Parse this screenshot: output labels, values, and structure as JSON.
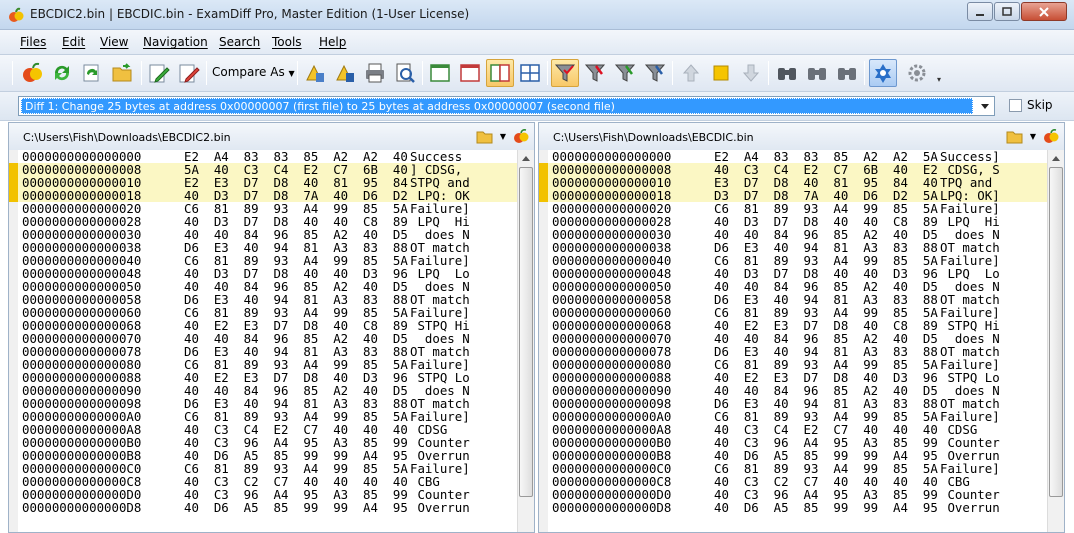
{
  "window": {
    "title": "EBCDIC2.bin  |  EBCDIC.bin - ExamDiff Pro, Master Edition (1-User License)"
  },
  "menu": [
    "Files",
    "Edit",
    "View",
    "Navigation",
    "Search",
    "Tools",
    "Help"
  ],
  "toolbar": {
    "compare_as_label": "Compare As"
  },
  "diff_nav": {
    "current": "Diff 1: Change 25 bytes at address 0x00000007 (first file) to 25 bytes at address 0x00000007 (second file)",
    "skip_label": "Skip"
  },
  "left_pane": {
    "path": "C:\\Users\\Fish\\Downloads\\EBCDIC2.bin",
    "rows": [
      {
        "addr": "0000000000000000",
        "bytes": "E2  A4  83  83  85  A2  A2  40",
        "ascii": "Success "
      },
      {
        "addr": "0000000000000008",
        "bytes": "5A  40  C3  C4  E2  C7  6B  40",
        "ascii": "] CDSG, "
      },
      {
        "addr": "0000000000000010",
        "bytes": "E2  E3  D7  D8  40  81  95  84",
        "ascii": "STPQ and"
      },
      {
        "addr": "0000000000000018",
        "bytes": "40  D3  D7  D8  7A  40  D6  D2",
        "ascii": " LPQ: OK"
      },
      {
        "addr": "0000000000000020",
        "bytes": "C6  81  89  93  A4  99  85  5A",
        "ascii": "Failure]"
      },
      {
        "addr": "0000000000000028",
        "bytes": "40  D3  D7  D8  40  40  C8  89",
        "ascii": " LPQ  Hi"
      },
      {
        "addr": "0000000000000030",
        "bytes": "40  40  84  96  85  A2  40  D5",
        "ascii": "  does N"
      },
      {
        "addr": "0000000000000038",
        "bytes": "D6  E3  40  94  81  A3  83  88",
        "ascii": "OT match"
      },
      {
        "addr": "0000000000000040",
        "bytes": "C6  81  89  93  A4  99  85  5A",
        "ascii": "Failure]"
      },
      {
        "addr": "0000000000000048",
        "bytes": "40  D3  D7  D8  40  40  D3  96",
        "ascii": " LPQ  Lo"
      },
      {
        "addr": "0000000000000050",
        "bytes": "40  40  84  96  85  A2  40  D5",
        "ascii": "  does N"
      },
      {
        "addr": "0000000000000058",
        "bytes": "D6  E3  40  94  81  A3  83  88",
        "ascii": "OT match"
      },
      {
        "addr": "0000000000000060",
        "bytes": "C6  81  89  93  A4  99  85  5A",
        "ascii": "Failure]"
      },
      {
        "addr": "0000000000000068",
        "bytes": "40  E2  E3  D7  D8  40  C8  89",
        "ascii": " STPQ Hi"
      },
      {
        "addr": "0000000000000070",
        "bytes": "40  40  84  96  85  A2  40  D5",
        "ascii": "  does N"
      },
      {
        "addr": "0000000000000078",
        "bytes": "D6  E3  40  94  81  A3  83  88",
        "ascii": "OT match"
      },
      {
        "addr": "0000000000000080",
        "bytes": "C6  81  89  93  A4  99  85  5A",
        "ascii": "Failure]"
      },
      {
        "addr": "0000000000000088",
        "bytes": "40  E2  E3  D7  D8  40  D3  96",
        "ascii": " STPQ Lo"
      },
      {
        "addr": "0000000000000090",
        "bytes": "40  40  84  96  85  A2  40  D5",
        "ascii": "  does N"
      },
      {
        "addr": "0000000000000098",
        "bytes": "D6  E3  40  94  81  A3  83  88",
        "ascii": "OT match"
      },
      {
        "addr": "00000000000000A0",
        "bytes": "C6  81  89  93  A4  99  85  5A",
        "ascii": "Failure]"
      },
      {
        "addr": "00000000000000A8",
        "bytes": "40  C3  C4  E2  C7  40  40  40",
        "ascii": " CDSG   "
      },
      {
        "addr": "00000000000000B0",
        "bytes": "40  C3  96  A4  95  A3  85  99",
        "ascii": " Counter"
      },
      {
        "addr": "00000000000000B8",
        "bytes": "40  D6  A5  85  99  99  A4  95",
        "ascii": " Overrun"
      },
      {
        "addr": "00000000000000C0",
        "bytes": "C6  81  89  93  A4  99  85  5A",
        "ascii": "Failure]"
      },
      {
        "addr": "00000000000000C8",
        "bytes": "40  C3  C2  C7  40  40  40  40",
        "ascii": " CBG    "
      },
      {
        "addr": "00000000000000D0",
        "bytes": "40  C3  96  A4  95  A3  85  99",
        "ascii": " Counter"
      },
      {
        "addr": "00000000000000D8",
        "bytes": "40  D6  A5  85  99  99  A4  95",
        "ascii": " Overrun"
      }
    ]
  },
  "right_pane": {
    "path": "C:\\Users\\Fish\\Downloads\\EBCDIC.bin",
    "rows": [
      {
        "addr": "0000000000000000",
        "bytes": "E2  A4  83  83  85  A2  A2  5A",
        "ascii": "Success]"
      },
      {
        "addr": "0000000000000008",
        "bytes": "40  C3  C4  E2  C7  6B  40  E2",
        "ascii": " CDSG, S"
      },
      {
        "addr": "0000000000000010",
        "bytes": "E3  D7  D8  40  81  95  84  40",
        "ascii": "TPQ and "
      },
      {
        "addr": "0000000000000018",
        "bytes": "D3  D7  D8  7A  40  D6  D2  5A",
        "ascii": "LPQ: OK]"
      },
      {
        "addr": "0000000000000020",
        "bytes": "C6  81  89  93  A4  99  85  5A",
        "ascii": "Failure]"
      },
      {
        "addr": "0000000000000028",
        "bytes": "40  D3  D7  D8  40  40  C8  89",
        "ascii": " LPQ  Hi"
      },
      {
        "addr": "0000000000000030",
        "bytes": "40  40  84  96  85  A2  40  D5",
        "ascii": "  does N"
      },
      {
        "addr": "0000000000000038",
        "bytes": "D6  E3  40  94  81  A3  83  88",
        "ascii": "OT match"
      },
      {
        "addr": "0000000000000040",
        "bytes": "C6  81  89  93  A4  99  85  5A",
        "ascii": "Failure]"
      },
      {
        "addr": "0000000000000048",
        "bytes": "40  D3  D7  D8  40  40  D3  96",
        "ascii": " LPQ  Lo"
      },
      {
        "addr": "0000000000000050",
        "bytes": "40  40  84  96  85  A2  40  D5",
        "ascii": "  does N"
      },
      {
        "addr": "0000000000000058",
        "bytes": "D6  E3  40  94  81  A3  83  88",
        "ascii": "OT match"
      },
      {
        "addr": "0000000000000060",
        "bytes": "C6  81  89  93  A4  99  85  5A",
        "ascii": "Failure]"
      },
      {
        "addr": "0000000000000068",
        "bytes": "40  E2  E3  D7  D8  40  C8  89",
        "ascii": " STPQ Hi"
      },
      {
        "addr": "0000000000000070",
        "bytes": "40  40  84  96  85  A2  40  D5",
        "ascii": "  does N"
      },
      {
        "addr": "0000000000000078",
        "bytes": "D6  E3  40  94  81  A3  83  88",
        "ascii": "OT match"
      },
      {
        "addr": "0000000000000080",
        "bytes": "C6  81  89  93  A4  99  85  5A",
        "ascii": "Failure]"
      },
      {
        "addr": "0000000000000088",
        "bytes": "40  E2  E3  D7  D8  40  D3  96",
        "ascii": " STPQ Lo"
      },
      {
        "addr": "0000000000000090",
        "bytes": "40  40  84  96  85  A2  40  D5",
        "ascii": "  does N"
      },
      {
        "addr": "0000000000000098",
        "bytes": "D6  E3  40  94  81  A3  83  88",
        "ascii": "OT match"
      },
      {
        "addr": "00000000000000A0",
        "bytes": "C6  81  89  93  A4  99  85  5A",
        "ascii": "Failure]"
      },
      {
        "addr": "00000000000000A8",
        "bytes": "40  C3  C4  E2  C7  40  40  40",
        "ascii": " CDSG   "
      },
      {
        "addr": "00000000000000B0",
        "bytes": "40  C3  96  A4  95  A3  85  99",
        "ascii": " Counter"
      },
      {
        "addr": "00000000000000B8",
        "bytes": "40  D6  A5  85  99  99  A4  95",
        "ascii": " Overrun"
      },
      {
        "addr": "00000000000000C0",
        "bytes": "C6  81  89  93  A4  99  85  5A",
        "ascii": "Failure]"
      },
      {
        "addr": "00000000000000C8",
        "bytes": "40  C3  C2  C7  40  40  40  40",
        "ascii": " CBG    "
      },
      {
        "addr": "00000000000000D0",
        "bytes": "40  C3  96  A4  95  A3  85  99",
        "ascii": " Counter"
      },
      {
        "addr": "00000000000000D8",
        "bytes": "40  D6  A5  85  99  99  A4  95",
        "ascii": " Overrun"
      }
    ]
  },
  "changed_rows": [
    1,
    2,
    3
  ],
  "colors": {
    "changed_line_bg": "#fbf7c4",
    "changed_gutter": "#f2c200",
    "selection": "#3399ff"
  },
  "icons": {
    "toolbar": [
      "compare-icon",
      "refresh-icon",
      "refresh-all-icon",
      "open-folder-icon",
      "edit-first-icon",
      "edit-second-icon",
      "compare-as-dropdown",
      "first-diff-icon",
      "prev-diff-icon",
      "print-icon",
      "print-preview-icon",
      "view-left-icon",
      "view-right-icon",
      "view-split-icon",
      "view-grid-icon",
      "filter-all-icon",
      "filter-changed-icon",
      "filter-added-icon",
      "filter-deleted-icon",
      "prev-change-icon",
      "current-change-icon",
      "next-change-icon",
      "find-icon",
      "find-next-icon",
      "find-prev-icon",
      "sync-icon",
      "options-icon"
    ]
  }
}
